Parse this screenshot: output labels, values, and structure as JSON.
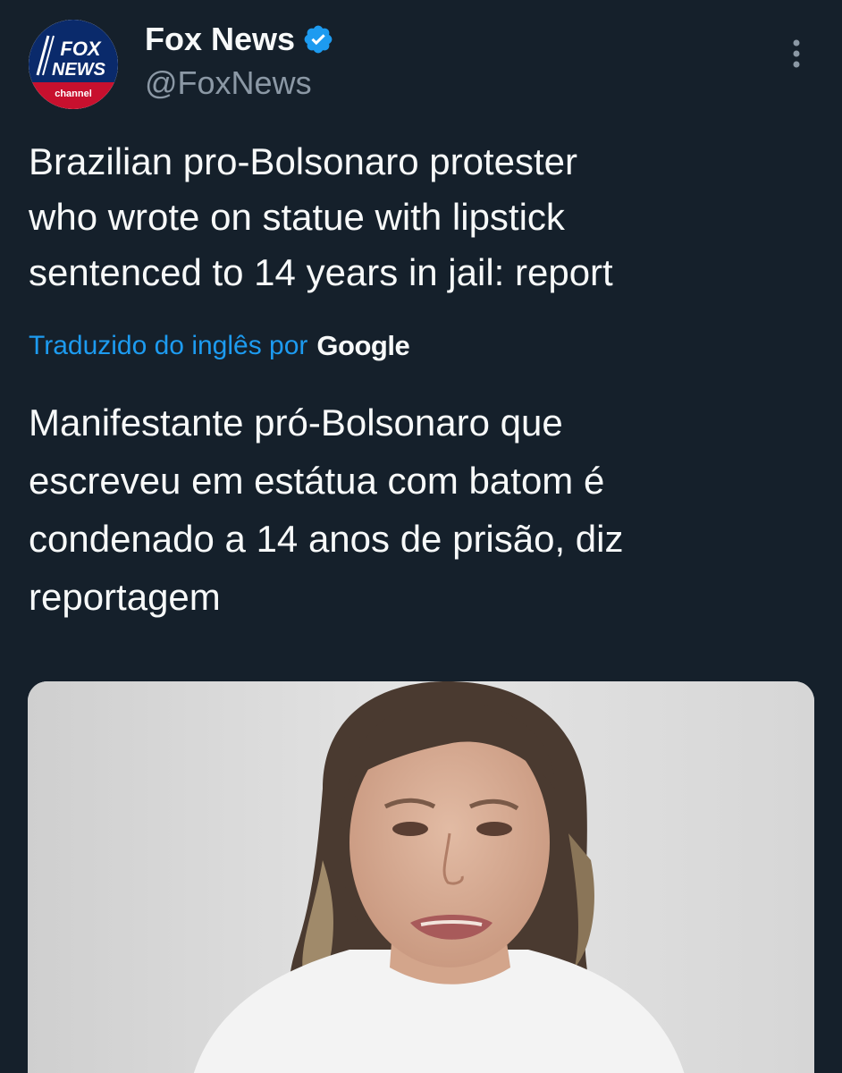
{
  "account": {
    "display_name": "Fox News",
    "handle": "@FoxNews",
    "avatar_logo_lines": [
      "FOX",
      "NEWS",
      "channel"
    ]
  },
  "tweet": {
    "text_lines": [
      "Brazilian pro-Bolsonaro protester",
      "who wrote on statue with lipstick",
      "sentenced to 14 years in jail: report"
    ],
    "translation_label": "Traduzido do inglês por",
    "translation_provider": "Google",
    "translated_lines": [
      "Manifestante pró-Bolsonaro que",
      "escreveu em estátua com batom é",
      "condenado a 14 anos de prisão, diz",
      "reportagem"
    ]
  },
  "icons": {
    "verified": "verified-badge-icon",
    "more": "more-options-icon"
  },
  "colors": {
    "background": "#15202b",
    "text": "#f7f9f9",
    "secondary_text": "#8b98a5",
    "link": "#1d9bf0",
    "fox_blue": "#0a2a6b",
    "fox_red": "#c8102e"
  }
}
